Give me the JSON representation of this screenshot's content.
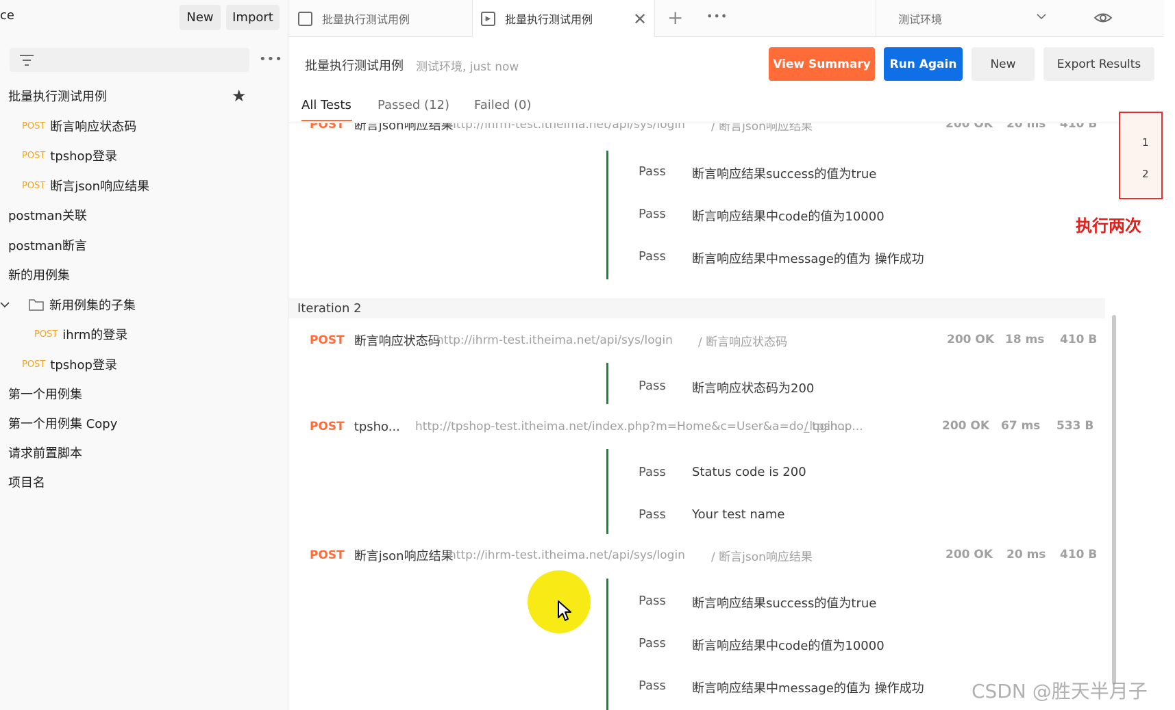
{
  "sidebar": {
    "workspace_title": "ce",
    "new_label": "New",
    "import_label": "Import",
    "search_placeholder": "",
    "more_label": "•••",
    "items": [
      {
        "label": "批量执行测试用例",
        "type": "collection"
      },
      {
        "method": "POST",
        "label": "断言响应状态码"
      },
      {
        "method": "POST",
        "label": "tpshop登录"
      },
      {
        "method": "POST",
        "label": "断言json响应结果"
      },
      {
        "label": "postman关联"
      },
      {
        "label": "postman断言"
      },
      {
        "label": "新的用例集"
      },
      {
        "label": "新用例集的子集",
        "type": "folder"
      },
      {
        "method": "POST",
        "label": "ihrm的登录"
      },
      {
        "method": "POST",
        "label": "tpshop登录"
      },
      {
        "label": "第一个用例集"
      },
      {
        "label": "第一个用例集 Copy"
      },
      {
        "label": "请求前置脚本"
      },
      {
        "label": "项目名"
      }
    ]
  },
  "tabs": {
    "tab1_label": "批量执行测试用例",
    "tab2_label": "批量执行测试用例",
    "more_label": "•••",
    "environment": "测试环境"
  },
  "runner": {
    "title": "批量执行测试用例",
    "subtitle": "测试环境, just now",
    "view_summary_label": "View Summary",
    "run_again_label": "Run Again",
    "new_label": "New",
    "export_label": "Export Results",
    "filter_all": "All Tests",
    "filter_passed": "Passed (12)",
    "filter_failed": "Failed (0)"
  },
  "results": {
    "top_request": {
      "method": "POST",
      "name": "断言json响应结果",
      "url": "http://ihrm-test.itheima.net/api/sys/login",
      "folder": "/ 断言json响应结果",
      "status": "200 OK",
      "time": "20 ms",
      "size": "410 B"
    },
    "top_tests": [
      {
        "result": "Pass",
        "name": "断言响应结果success的值为true"
      },
      {
        "result": "Pass",
        "name": "断言响应结果中code的值为10000"
      },
      {
        "result": "Pass",
        "name": "断言响应结果中message的值为 操作成功"
      }
    ],
    "iteration2_label": "Iteration 2",
    "req1": {
      "method": "POST",
      "name": "断言响应状态码",
      "url": "http://ihrm-test.itheima.net/api/sys/login",
      "folder": "/ 断言响应状态码",
      "status": "200 OK",
      "time": "18 ms",
      "size": "410 B"
    },
    "req1_tests": [
      {
        "result": "Pass",
        "name": "断言响应状态码为200"
      }
    ],
    "req2": {
      "method": "POST",
      "name": "tpsho...",
      "url": "http://tpshop-test.itheima.net/index.php?m=Home&c=User&a=do_login...",
      "folder": "/ tpshop...",
      "status": "200 OK",
      "time": "67 ms",
      "size": "533 B"
    },
    "req2_tests": [
      {
        "result": "Pass",
        "name": "Status code is 200"
      },
      {
        "result": "Pass",
        "name": "Your test name"
      }
    ],
    "req3": {
      "method": "POST",
      "name": "断言json响应结果",
      "url": "http://ihrm-test.itheima.net/api/sys/login",
      "folder": "/ 断言json响应结果",
      "status": "200 OK",
      "time": "20 ms",
      "size": "410 B"
    },
    "req3_tests": [
      {
        "result": "Pass",
        "name": "断言响应结果success的值为true"
      },
      {
        "result": "Pass",
        "name": "断言响应结果中code的值为10000"
      },
      {
        "result": "Pass",
        "name": "断言响应结果中message的值为 操作成功"
      }
    ]
  },
  "iterations": [
    "1",
    "2"
  ],
  "annotation": "执行两次",
  "watermark": "CSDN @胜天半月子",
  "colors": {
    "accent_orange": "#ff6c37",
    "primary_blue": "#0f6fe6",
    "pass_green": "#138a36",
    "method_orange": "#f2a520",
    "annotation_red": "#e0201a"
  },
  "icons": [
    "filter-icon",
    "star-icon",
    "folder-icon",
    "runner-tab-icon",
    "close-icon",
    "plus-icon",
    "eye-icon",
    "chevron-down-icon",
    "cursor-icon"
  ]
}
